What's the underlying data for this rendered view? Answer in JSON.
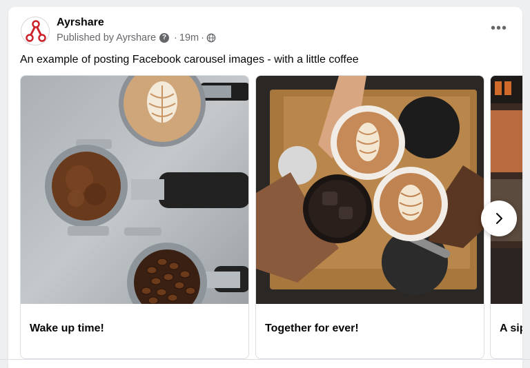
{
  "post": {
    "page_name": "Ayrshare",
    "published_by": "Published by Ayrshare",
    "help_icon": "question-icon",
    "time": "19m",
    "audience_icon": "globe-icon",
    "more_icon": "more-horizontal-icon",
    "caption": "An example of posting Facebook carousel images - with a little coffee"
  },
  "carousel": {
    "cards": [
      {
        "title": "Wake up time!",
        "image": "espresso-portafilters-photo"
      },
      {
        "title": "Together for ever!",
        "image": "cheers-coffee-cups-photo"
      },
      {
        "title": "A sip",
        "image": "partial-photo"
      }
    ],
    "next_icon": "chevron-right-icon"
  }
}
